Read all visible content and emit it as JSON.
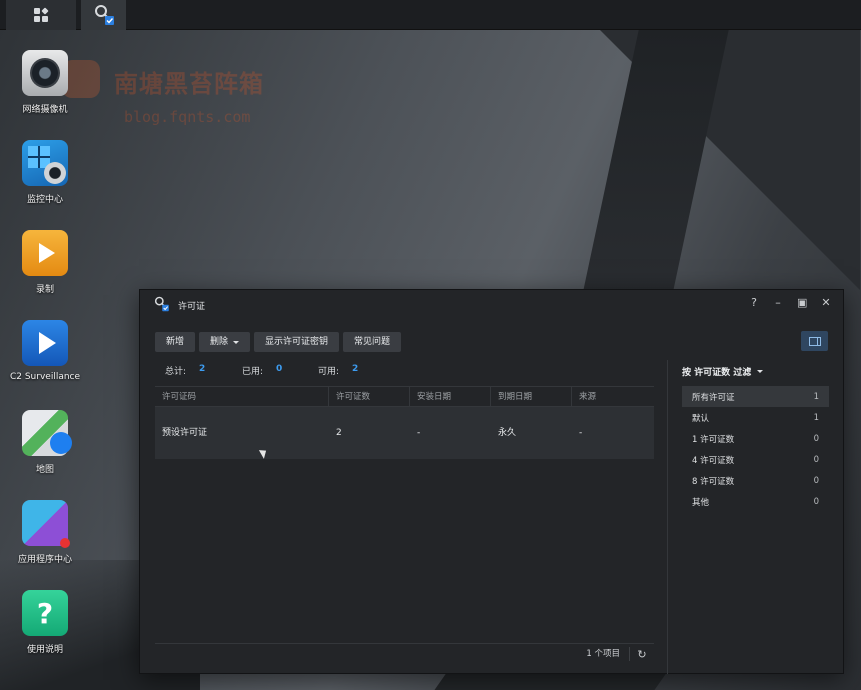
{
  "taskbar": {
    "main_icon": "main-menu-grid-icon",
    "app_icon": "license-app-icon"
  },
  "desktop": {
    "icons": [
      {
        "label": "网络摄像机",
        "icon": "ip-camera-icon"
      },
      {
        "label": "监控中心",
        "icon": "monitor-center-icon"
      },
      {
        "label": "录制",
        "icon": "recording-icon"
      },
      {
        "label": "C2 Surveillance",
        "icon": "c2-surveillance-icon"
      },
      {
        "label": "地图",
        "icon": "map-icon"
      },
      {
        "label": "应用程序中心",
        "icon": "package-center-icon"
      },
      {
        "label": "使用说明",
        "icon": "help-icon"
      }
    ],
    "watermark": {
      "title": "南塘黑苔阵箱",
      "url": "blog.fqnts.com"
    }
  },
  "window": {
    "title": "许可证",
    "controls": {
      "help": "?",
      "minimize": "–",
      "maximize": "▣",
      "close": "✕"
    },
    "toolbar": {
      "add": "新增",
      "delete": "删除",
      "show_key": "显示许可证密钥",
      "faq": "常见问题"
    },
    "stats": {
      "total_label": "总计:",
      "total_value": "2",
      "used_label": "已用:",
      "used_value": "0",
      "available_label": "可用:",
      "available_value": "2"
    },
    "table": {
      "columns": [
        "许可证码",
        "许可证数",
        "安装日期",
        "到期日期",
        "来源"
      ],
      "rows": [
        {
          "code": "预设许可证",
          "count": "2",
          "install_date": "-",
          "expire_date": "永久",
          "source": "-"
        }
      ],
      "footer_count": "1 个项目"
    },
    "filter": {
      "heading": "按 许可证数 过滤",
      "items": [
        {
          "label": "所有许可证",
          "count": "1",
          "active": true
        },
        {
          "label": "默认",
          "count": "1"
        },
        {
          "label": "1 许可证数",
          "count": "0"
        },
        {
          "label": "4 许可证数",
          "count": "0"
        },
        {
          "label": "8 许可证数",
          "count": "0"
        },
        {
          "label": "其他",
          "count": "0"
        }
      ]
    }
  },
  "colors": {
    "accent": "#3d9cf0",
    "window_bg": "#232528",
    "taskbar_bg": "#1c1e21"
  }
}
